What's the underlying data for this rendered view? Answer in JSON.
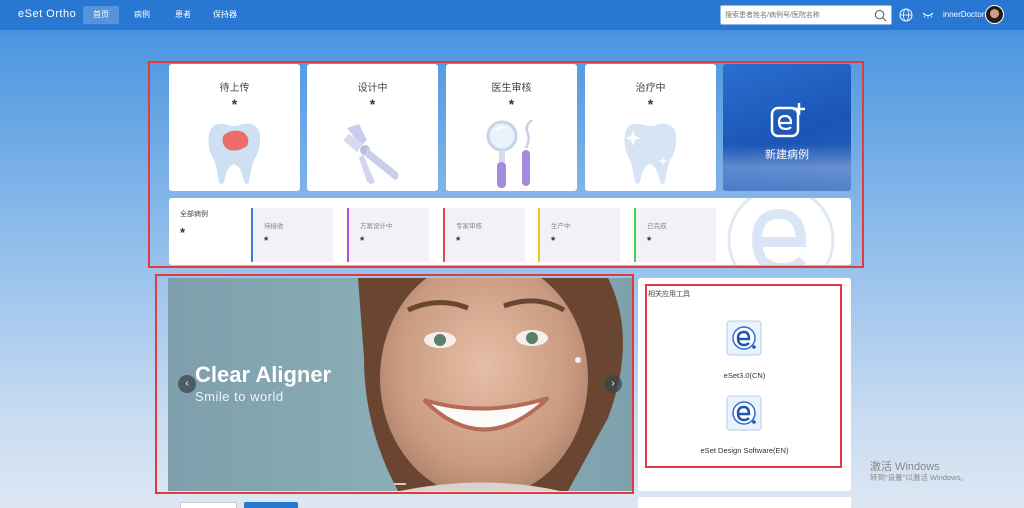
{
  "header": {
    "logo": "eSet Ortho",
    "nav": [
      "首页",
      "病例",
      "患者",
      "保持器"
    ],
    "active_index": 0,
    "search_placeholder": "搜索患者姓名/病例号/医院名称",
    "username": "innerDoctor"
  },
  "status_cards": [
    {
      "label": "待上传",
      "count": "*",
      "icon": "tooth-red-icon"
    },
    {
      "label": "设计中",
      "count": "*",
      "icon": "dental-pliers-icon"
    },
    {
      "label": "医生审核",
      "count": "*",
      "icon": "dental-mirror-icon"
    },
    {
      "label": "治疗中",
      "count": "*",
      "icon": "sparkling-tooth-icon"
    }
  ],
  "new_case": {
    "label": "新建病例",
    "icon": "e-plus-icon"
  },
  "summary": {
    "all_label": "全部病例",
    "all_count": "*",
    "items": [
      {
        "label": "待接收",
        "count": "*",
        "color": "#3d7fdc"
      },
      {
        "label": "方案设计中",
        "count": "*",
        "color": "#b34be0"
      },
      {
        "label": "专家审核",
        "count": "*",
        "color": "#e84a4a"
      },
      {
        "label": "生产中",
        "count": "*",
        "color": "#f0c030"
      },
      {
        "label": "已完成",
        "count": "*",
        "color": "#3fd24a"
      }
    ]
  },
  "banner": {
    "title": "Clear Aligner",
    "subtitle": "Smile to world"
  },
  "tools": {
    "title": "相关应用工具",
    "items": [
      {
        "label": "eSet3.0(CN)",
        "icon": "eset-app-icon"
      },
      {
        "label": "eSet Design Software(EN)",
        "icon": "eset-app-icon"
      }
    ]
  },
  "watermark": {
    "line1": "激活 Windows",
    "line2": "转到\"设置\"以激活 Windows。"
  },
  "colors": {
    "header": "#2877d2",
    "highlight": "#e13b3b",
    "new_case": "#1b55b5"
  }
}
